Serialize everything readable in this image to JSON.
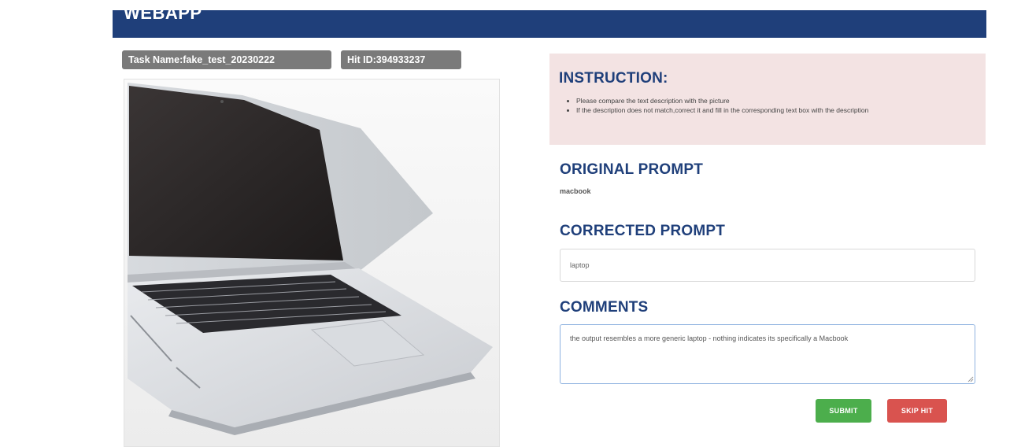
{
  "header": {
    "brand": "WEBAPP",
    "color": "#1f3f7a"
  },
  "task": {
    "name_badge": "Task Name:fake_test_20230222",
    "hit_badge": "Hit ID:394933237"
  },
  "image": {
    "subject_icon": "laptop-photo"
  },
  "instruction": {
    "title": "INSTRUCTION:",
    "items": [
      "Please compare the text description with the picture",
      "If the description does not match,correct it and fill in the corresponding text box with the description"
    ]
  },
  "original_prompt": {
    "title": "ORIGINAL PROMPT",
    "value": "macbook"
  },
  "corrected_prompt": {
    "title": "CORRECTED PROMPT",
    "value": "laptop"
  },
  "comments": {
    "title": "COMMENTS",
    "value": "the output resembles a more generic laptop - nothing indicates its specifically a Macbook"
  },
  "actions": {
    "submit_label": "SUBMIT",
    "skip_label": "SKIP HIT",
    "submit_color": "#4cae4c",
    "skip_color": "#d9534f"
  }
}
